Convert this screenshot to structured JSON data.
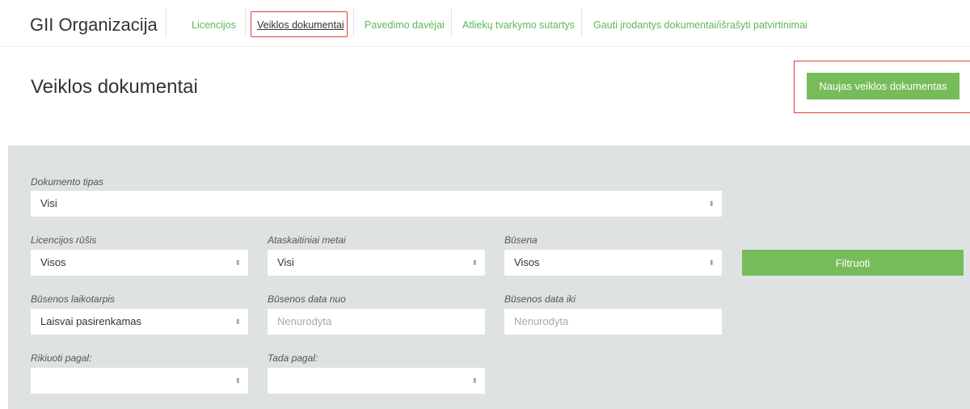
{
  "header": {
    "brand": "GII Organizacija",
    "nav": [
      {
        "label": "Licencijos"
      },
      {
        "label": "Veiklos dokumentai"
      },
      {
        "label": "Pavedimo davėjai"
      },
      {
        "label": "Atliekų tvarkymo sutartys"
      },
      {
        "label": "Gauti įrodantys dokumentai/išrašyti patvirtinimai"
      }
    ]
  },
  "main": {
    "title": "Veiklos dokumentai",
    "new_button": "Naujas veiklos dokumentas"
  },
  "filters": {
    "dokumento_tipas": {
      "label": "Dokumento tipas",
      "value": "Visi"
    },
    "licencijos_rusis": {
      "label": "Licencijos rūšis",
      "value": "Visos"
    },
    "ataskaitiniai_metai": {
      "label": "Ataskaitiniai metai",
      "value": "Visi"
    },
    "busena": {
      "label": "Būsena",
      "value": "Visos"
    },
    "busenos_laikotarpis": {
      "label": "Būsenos laikotarpis",
      "value": "Laisvai pasirenkamas"
    },
    "busenos_data_nuo": {
      "label": "Būsenos data nuo",
      "placeholder": "Nenurodyta"
    },
    "busenos_data_iki": {
      "label": "Būsenos data iki",
      "placeholder": "Nenurodyta"
    },
    "rikiuoti_pagal": {
      "label": "Rikiuoti pagal:",
      "value": ""
    },
    "tada_pagal": {
      "label": "Tada pagal:",
      "value": ""
    },
    "filter_button": "Filtruoti"
  },
  "colors": {
    "accent_green": "#77bc5a",
    "nav_link_green": "#5cb85c",
    "highlight_red": "#e03b3b",
    "panel_bg": "#dfe2e2"
  },
  "icons": {
    "select_arrows": "select-arrows-icon"
  }
}
